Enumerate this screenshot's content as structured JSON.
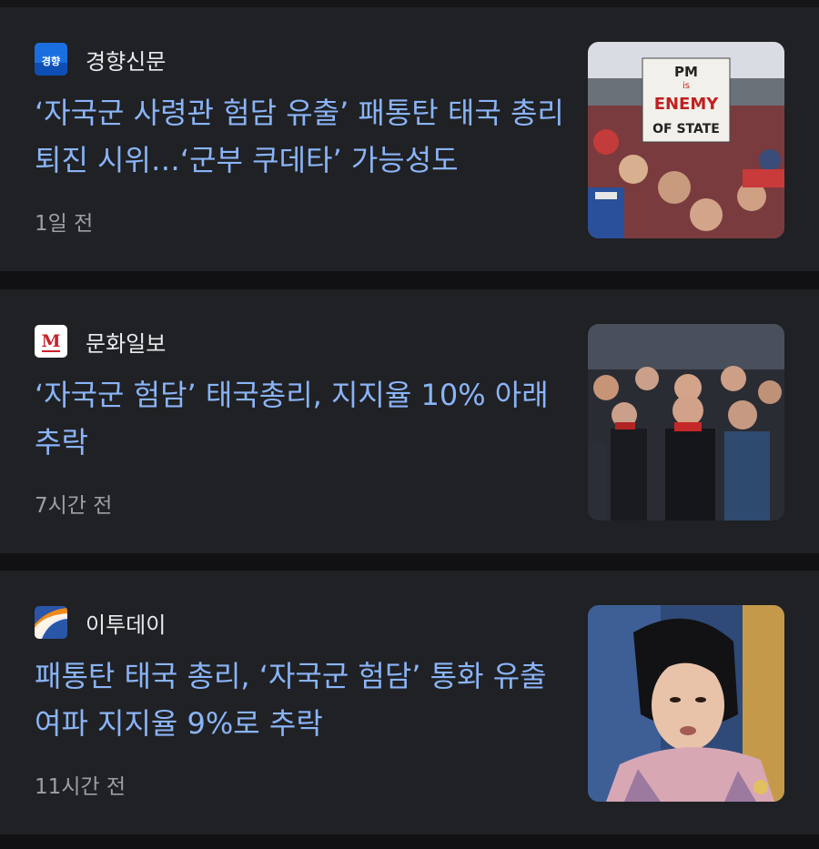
{
  "articles": [
    {
      "source": "경향신문",
      "logo_text": "경향",
      "headline": "‘자국군 사령관 험담 유출’ 패통탄 태국 총리 퇴진 시위…‘군부 쿠데타’ 가능성도",
      "time": "1일 전",
      "image_sign": [
        "PM",
        "is",
        "ENEMY",
        "OF STATE"
      ]
    },
    {
      "source": "문화일보",
      "logo_text": "M",
      "headline": "‘자국군 험담’ 태국총리, 지지율 10% 아래 추락",
      "time": "7시간 전"
    },
    {
      "source": "이투데이",
      "headline": "패통탄 태국 총리, ‘자국군 험담’ 통화 유출 여파 지지율 9%로 추락",
      "time": "11시간 전"
    }
  ],
  "colors": {
    "background": "#111113",
    "card": "#202124",
    "headline": "#8ab4f8",
    "source_text": "#e8eaed",
    "time_text": "#9aa0a6"
  },
  "icons": [
    "kyunghyang-logo-icon",
    "munhwa-logo-icon",
    "etoday-logo-icon"
  ]
}
